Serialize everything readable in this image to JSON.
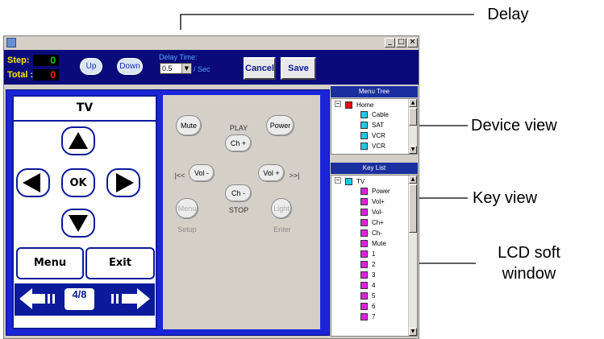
{
  "window": {
    "minimize": "_",
    "maximize": "□",
    "close": "×"
  },
  "toolbar": {
    "step_label": "Step:",
    "step_value": "0",
    "total_label": "Total :",
    "total_value": "0",
    "up_label": "Up",
    "down_label": "Down",
    "delay_label": "Delay Time:",
    "delay_value": "0.5",
    "delay_unit": "/ Sec",
    "cancel_label": "Cancel",
    "save_label": "Save"
  },
  "lcd": {
    "title": "TV",
    "ok_label": "OK",
    "menu_label": "Menu",
    "exit_label": "Exit",
    "page": "4/8"
  },
  "keypad": {
    "mute": "Mute",
    "power": "Power",
    "play": "PLAY",
    "ch_up": "Ch +",
    "skip_back": "|<<",
    "vol_down": "Vol -",
    "vol_up": "Vol +",
    "skip_fwd": ">>|",
    "ch_down": "Ch -",
    "stop": "STOP",
    "menu": "Menu",
    "light": "Light",
    "setup": "Setup",
    "enter": "Enter"
  },
  "menu_tree": {
    "header": "Menu Tree",
    "items": [
      {
        "label": "Home",
        "color": "#e01010"
      },
      {
        "label": "Cable",
        "color": "#20c8e8"
      },
      {
        "label": "SAT",
        "color": "#20c8e8"
      },
      {
        "label": "VCR",
        "color": "#20c8e8"
      },
      {
        "label": "VCR",
        "color": "#20c8e8"
      }
    ]
  },
  "key_list": {
    "header": "Key List",
    "root": {
      "label": "TV",
      "color": "#20c8e8"
    },
    "items": [
      "Power",
      "Vol+",
      "Vol-",
      "Ch+",
      "Ch-",
      "Mute",
      "1",
      "2",
      "3",
      "4",
      "5",
      "6",
      "7"
    ],
    "item_color": "#e020e0"
  },
  "callouts": {
    "delay": "Delay",
    "device_view": "Device view",
    "key_view": "Key view",
    "lcd_line1": "LCD soft",
    "lcd_line2": "window"
  }
}
